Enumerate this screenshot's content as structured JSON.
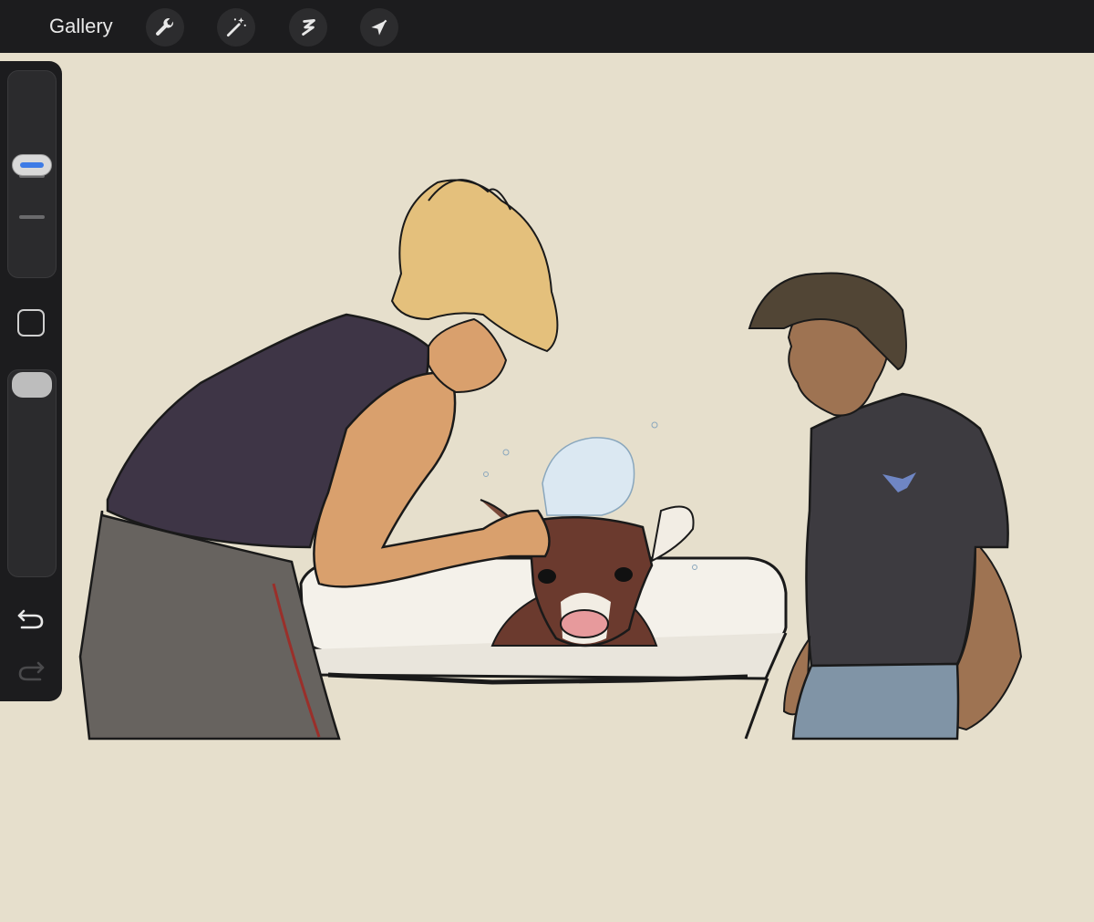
{
  "toolbar": {
    "gallery_label": "Gallery",
    "tools": [
      {
        "name": "wrench-icon"
      },
      {
        "name": "magic-wand-icon"
      },
      {
        "name": "selection-icon"
      },
      {
        "name": "arrow-cursor-icon"
      }
    ]
  },
  "sidebar": {
    "brush_size_level": 0.55,
    "opacity_level": 1.0,
    "undo_icon": "undo-icon",
    "redo_icon": "redo-icon",
    "redo_enabled": false
  },
  "colors": {
    "toolbar_bg": "#1c1c1e",
    "canvas_bg": "#e6dfcc",
    "accent_blue": "#3d7be6"
  }
}
